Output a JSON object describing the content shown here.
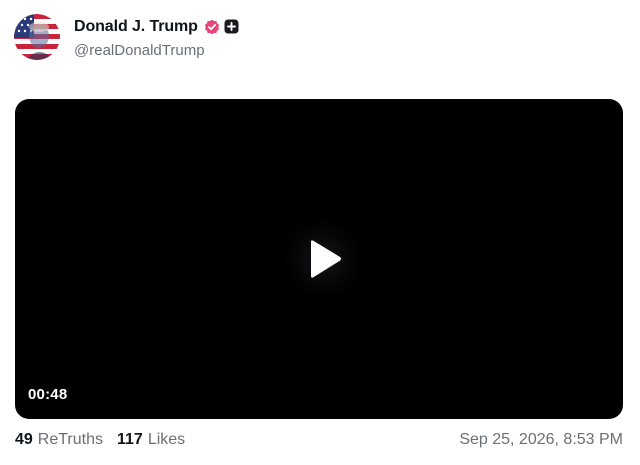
{
  "author": {
    "display_name": "Donald J. Trump",
    "handle": "@realDonaldTrump",
    "avatar_icon": "flag-portrait-avatar",
    "verified_icon": "verified-badge-icon",
    "verified_color": "#e8457a",
    "plus_icon": "plus-badge-icon"
  },
  "media": {
    "type": "video",
    "duration": "00:48",
    "play_icon": "play-icon",
    "background_color": "#000000"
  },
  "stats": {
    "retruths_count": "49",
    "retruths_label": "ReTruths",
    "likes_count": "117",
    "likes_label": "Likes"
  },
  "timestamp": "Sep 25, 2026, 8:53 PM"
}
